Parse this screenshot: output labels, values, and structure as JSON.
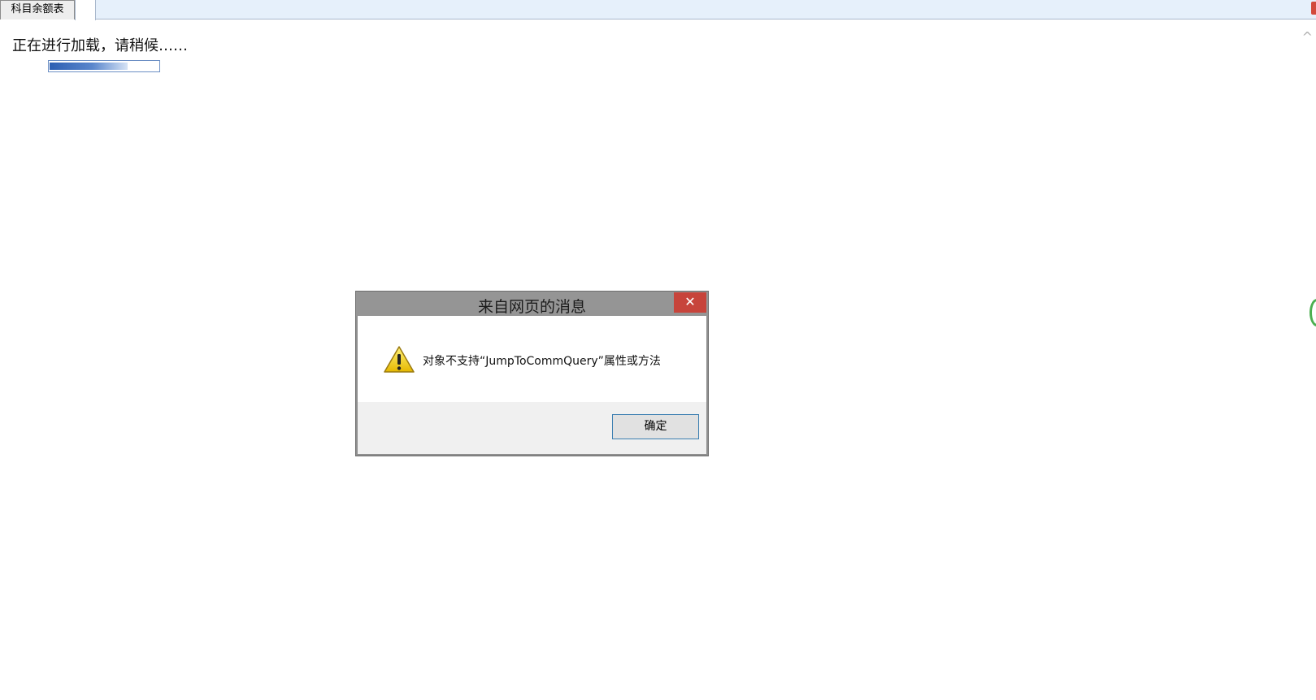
{
  "tabs": [
    {
      "label": "科目余额表",
      "active": true
    }
  ],
  "loading": {
    "message": "正在进行加载，请稍候……",
    "progress": 0.72
  },
  "dialog": {
    "title": "来自网页的消息",
    "close_symbol": "✕",
    "icon": "warning-icon",
    "message": "对象不支持“JumpToCommQuery”属性或方法",
    "ok_label": "确定"
  },
  "colors": {
    "close_button": "#c7443b",
    "title_bar": "#959595",
    "progress_fill": "#2d5fb2",
    "ok_border": "#3c7fb1"
  }
}
